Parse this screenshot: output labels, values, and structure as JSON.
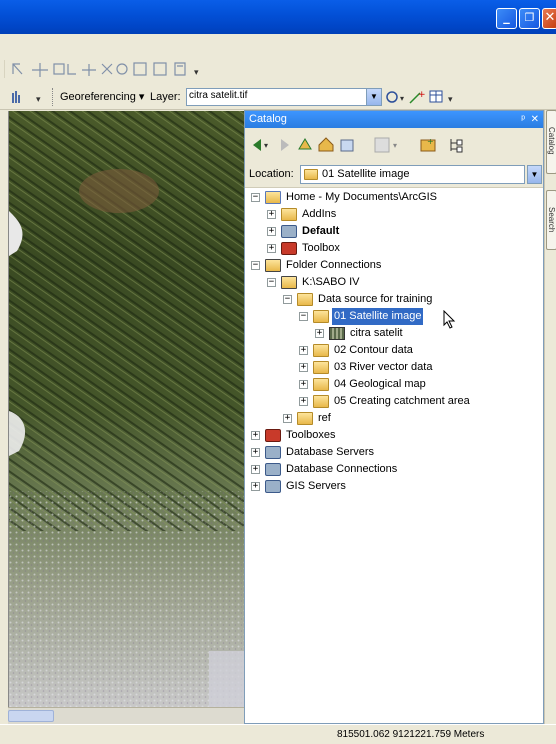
{
  "window": {
    "minimize_glyph": "_",
    "restore_glyph": "❐",
    "close_glyph": "✕"
  },
  "toolbar": {
    "georef_label": "Georeferencing ▾",
    "layer_label": "Layer:",
    "layer_value": "citra satelit.tif"
  },
  "catalog": {
    "title": "Catalog",
    "pin_glyph": "ᵖ",
    "close_glyph": "✕",
    "location_label": "Location:",
    "location_value": "01 Satellite image"
  },
  "tree": [
    {
      "label": "Home - My Documents\\ArcGIS",
      "expander": "⊟",
      "icon": "home-folder-icon"
    },
    {
      "label": "AddIns",
      "expander": "⊞",
      "icon": "folder-icon"
    },
    {
      "label": "Default",
      "expander": "⊞",
      "icon": "geodatabase-icon",
      "bold": true
    },
    {
      "label": "Toolbox",
      "expander": "⊞",
      "icon": "toolbox-icon"
    },
    {
      "label": "Folder Connections",
      "expander": "⊟",
      "icon": "folder-connections-icon"
    },
    {
      "label": "K:\\SABO IV",
      "expander": "⊟",
      "icon": "folder-connection-icon"
    },
    {
      "label": "Data source for training",
      "expander": "⊟",
      "icon": "folder-icon"
    },
    {
      "label": "01 Satellite image",
      "expander": "⊟",
      "icon": "open-folder-icon",
      "selected": true
    },
    {
      "label": "citra satelit",
      "expander": "⊞",
      "icon": "raster-icon"
    },
    {
      "label": "02 Contour data",
      "expander": "⊞",
      "icon": "folder-icon"
    },
    {
      "label": "03 River vector data",
      "expander": "⊞",
      "icon": "folder-icon"
    },
    {
      "label": "04 Geological map",
      "expander": "⊞",
      "icon": "folder-icon"
    },
    {
      "label": "05 Creating catchment area",
      "expander": "⊞",
      "icon": "folder-icon"
    },
    {
      "label": "ref",
      "expander": "⊞",
      "icon": "folder-icon"
    },
    {
      "label": "Toolboxes",
      "expander": "⊞",
      "icon": "toolboxes-icon"
    },
    {
      "label": "Database Servers",
      "expander": "⊞",
      "icon": "database-servers-icon"
    },
    {
      "label": "Database Connections",
      "expander": "⊞",
      "icon": "database-connections-icon"
    },
    {
      "label": "GIS Servers",
      "expander": "⊞",
      "icon": "gis-servers-icon"
    }
  ],
  "side_tabs": [
    "Catalog",
    "Search"
  ],
  "status": {
    "coordinates": "815501.062  9121221.759 Meters"
  },
  "colors": {
    "titlebar": "#0351d8",
    "selection": "#316ac5",
    "catalog_header": "#2a7de1"
  }
}
